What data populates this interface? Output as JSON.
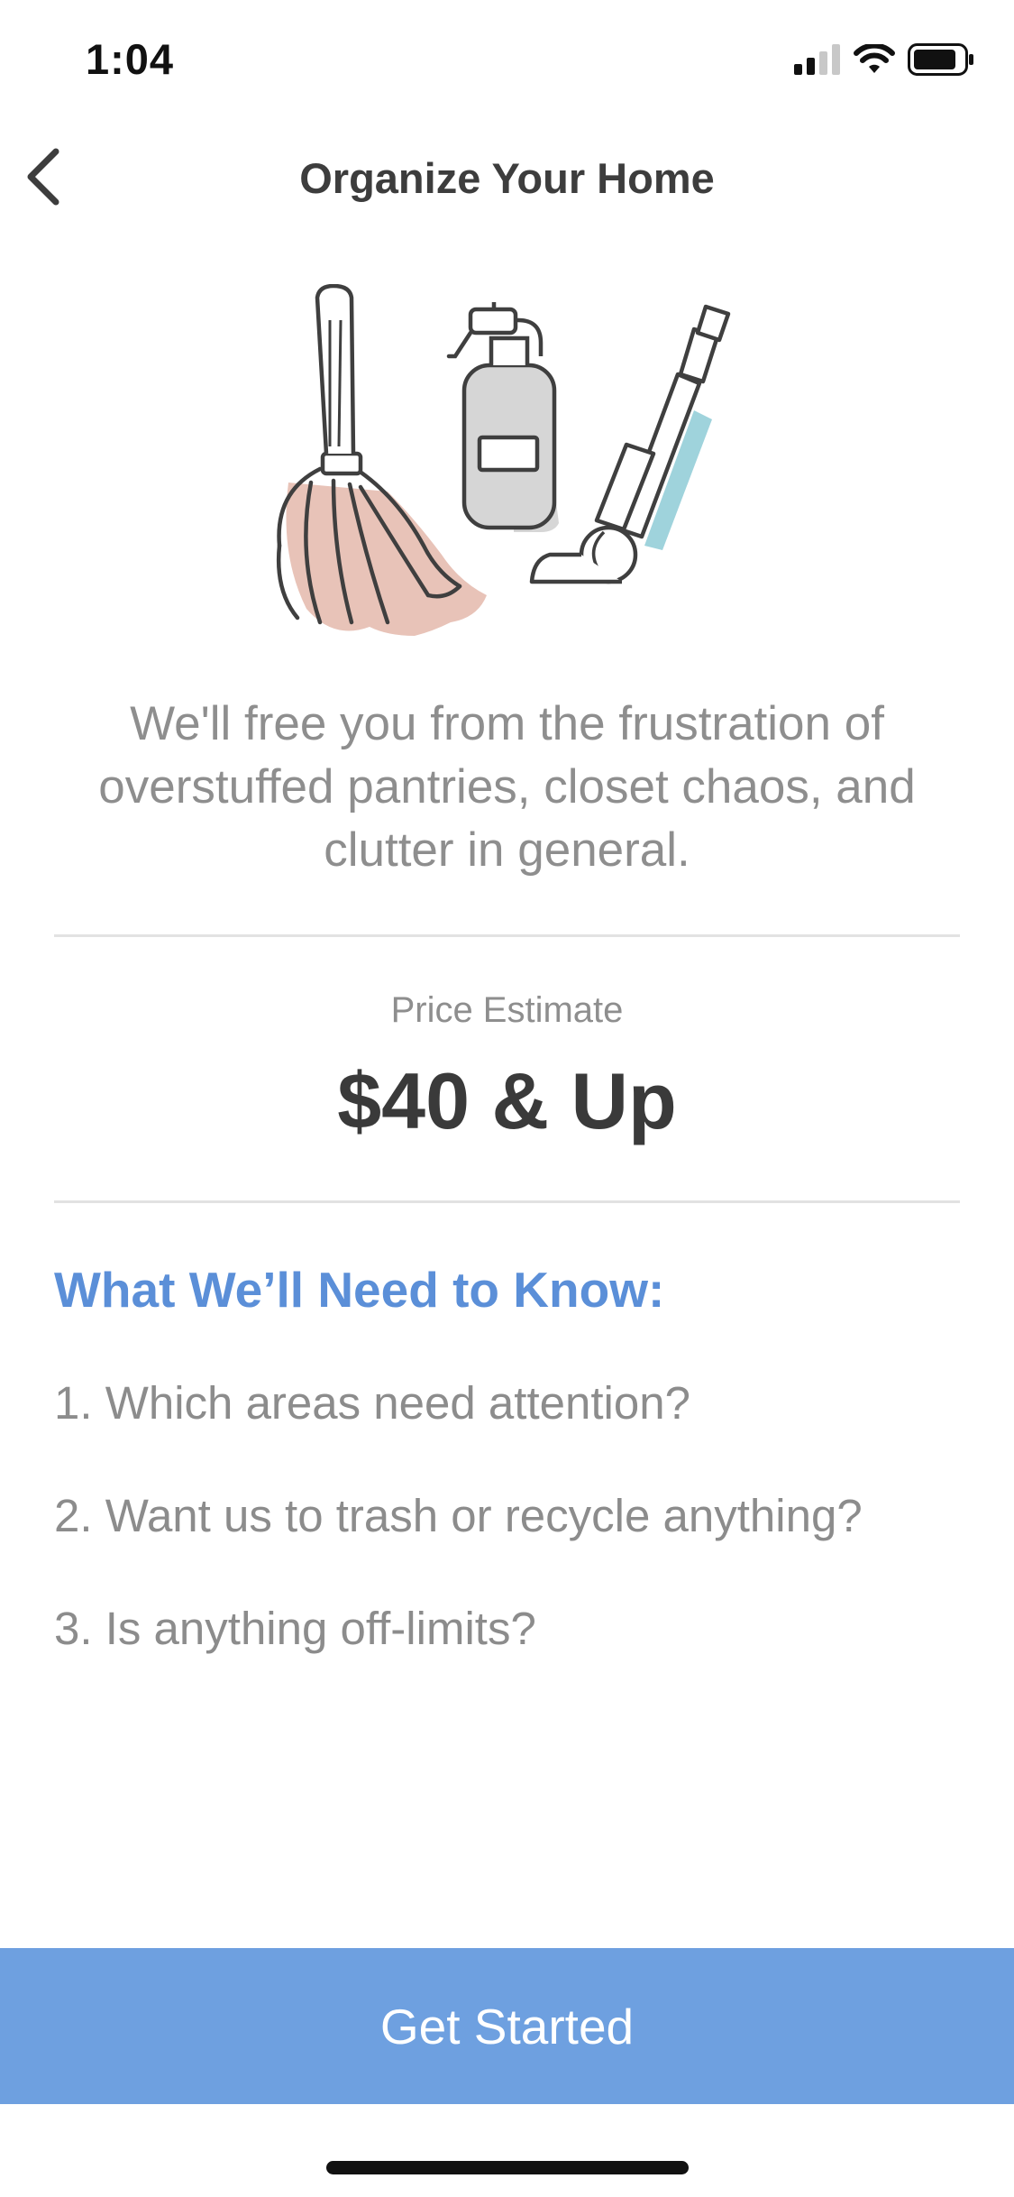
{
  "status_bar": {
    "time": "1:04",
    "icons": [
      "signal-icon",
      "wifi-icon",
      "battery-icon"
    ]
  },
  "nav": {
    "back_icon": "chevron-left-icon",
    "title": "Organize Your Home"
  },
  "illustration": {
    "items": [
      "feather-duster",
      "spray-bottle",
      "vacuum"
    ],
    "colors": {
      "outline": "#3f3f3f",
      "feather": "#e8c3b8",
      "bottle": "#d6d6d6",
      "vacuum_accent": "#9fd3dc"
    }
  },
  "description": "We'll free you from the frustration of overstuffed pantries, closet chaos, and clutter in general.",
  "price": {
    "label": "Price Estimate",
    "value": "$40 & Up"
  },
  "needs": {
    "heading": "What We’ll Need to Know:",
    "questions": [
      "1. Which areas need attention?",
      "2. Want us to trash or recycle anything?",
      "3. Is anything off-limits?"
    ]
  },
  "cta": {
    "label": "Get Started"
  },
  "colors": {
    "accent": "#5b8fd8",
    "button": "#6ea0e0",
    "muted_text": "#8e8e8e",
    "dark_text": "#3a3a3a"
  }
}
